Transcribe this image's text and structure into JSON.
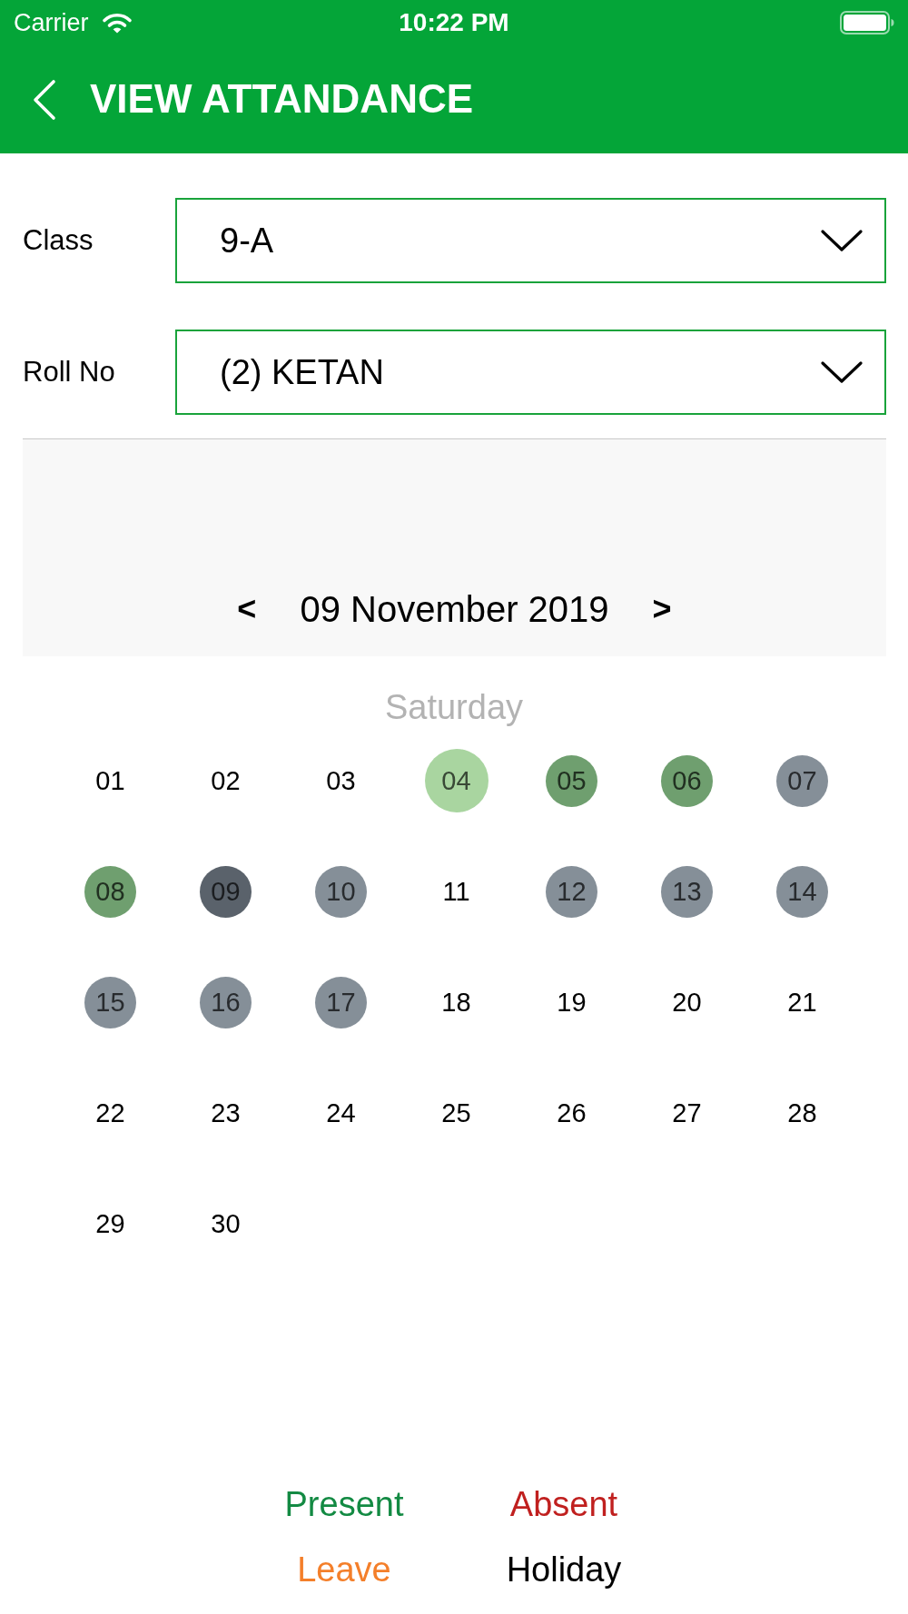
{
  "status_bar": {
    "carrier": "Carrier",
    "time": "10:22 PM"
  },
  "header": {
    "title": "VIEW ATTANDANCE"
  },
  "filters": [
    {
      "label": "Class",
      "value": "9-A"
    },
    {
      "label": "Roll No",
      "value": "(2) KETAN"
    }
  ],
  "calendar": {
    "prev": "<",
    "date": "09 November 2019",
    "next": ">",
    "weekday": "Saturday",
    "days": [
      {
        "label": "01",
        "selected": false
      },
      {
        "label": "02",
        "selected": false
      },
      {
        "label": "03",
        "selected": false
      },
      {
        "label": "04",
        "selected": true,
        "color": "#a9d5a0"
      },
      {
        "label": "05",
        "selected": false,
        "color": "#6f9f6f"
      },
      {
        "label": "06",
        "selected": false,
        "color": "#6f9f6f"
      },
      {
        "label": "07",
        "selected": false,
        "color": "#858f98"
      },
      {
        "label": "08",
        "selected": false,
        "color": "#6f9f6f"
      },
      {
        "label": "09",
        "selected": false,
        "color": "#5a626b"
      },
      {
        "label": "10",
        "selected": false,
        "color": "#858f98"
      },
      {
        "label": "11",
        "selected": false
      },
      {
        "label": "12",
        "selected": false,
        "color": "#858f98"
      },
      {
        "label": "13",
        "selected": false,
        "color": "#858f98"
      },
      {
        "label": "14",
        "selected": false,
        "color": "#858f98"
      },
      {
        "label": "15",
        "selected": false,
        "color": "#858f98"
      },
      {
        "label": "16",
        "selected": false,
        "color": "#858f98"
      },
      {
        "label": "17",
        "selected": false,
        "color": "#858f98"
      },
      {
        "label": "18",
        "selected": false
      },
      {
        "label": "19",
        "selected": false
      },
      {
        "label": "20",
        "selected": false
      },
      {
        "label": "21",
        "selected": false
      },
      {
        "label": "22",
        "selected": false
      },
      {
        "label": "23",
        "selected": false
      },
      {
        "label": "24",
        "selected": false
      },
      {
        "label": "25",
        "selected": false
      },
      {
        "label": "26",
        "selected": false
      },
      {
        "label": "27",
        "selected": false
      },
      {
        "label": "28",
        "selected": false
      },
      {
        "label": "29",
        "selected": false
      },
      {
        "label": "30",
        "selected": false
      }
    ]
  },
  "legend": [
    {
      "label": "Present",
      "color": "#138a43"
    },
    {
      "label": "Absent",
      "color": "#c0201f"
    },
    {
      "label": "Leave",
      "color": "#f47f2a"
    },
    {
      "label": "Holiday",
      "color": "#000000"
    }
  ]
}
